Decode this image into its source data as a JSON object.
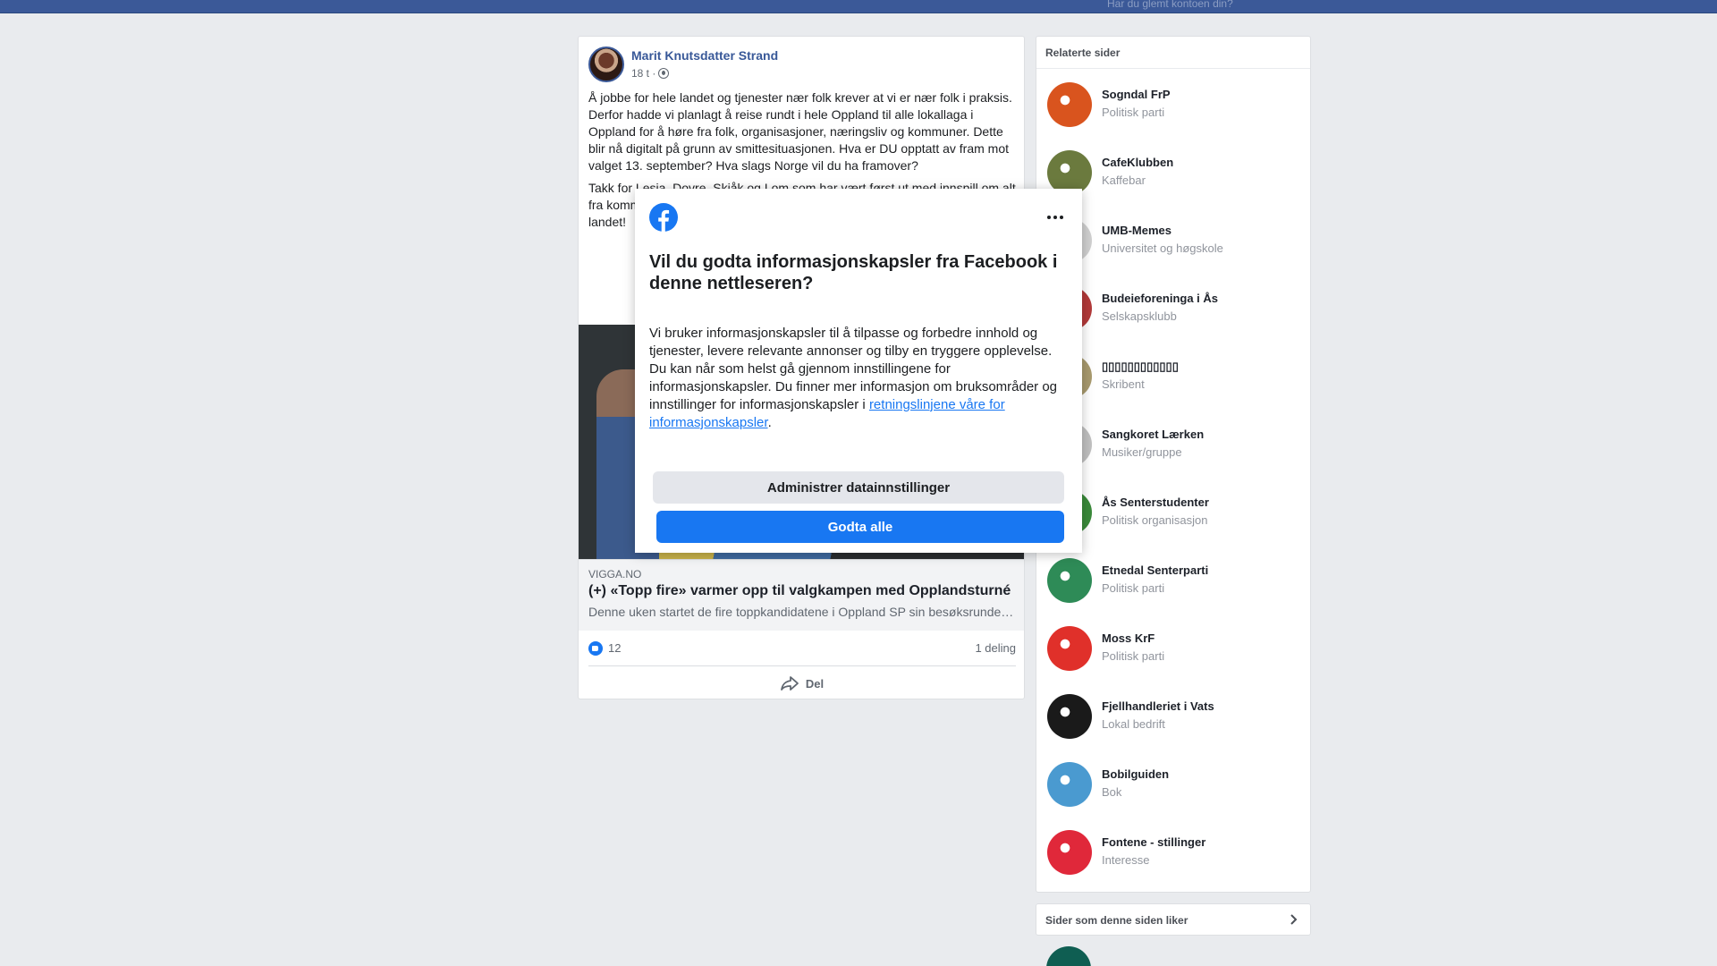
{
  "topbar": {
    "forgot_text": "Har du glemt kontoen din?"
  },
  "post": {
    "author": "Marit Knutsdatter Strand",
    "time": "18 t ·",
    "paragraph1": "Å jobbe for hele landet og tjenester nær folk krever at vi er nær folk i praksis. Derfor hadde vi planlagt å reise rundt i hele Oppland til alle lokallaga i Oppland for å høre fra folk, organisasjoner, næringsliv og kommuner. Dette blir nå digitalt på grunn av smittesituasjonen. Hva er DU opptatt av fram mot valget 13. september? Hva slags Norge vil du ha framover?",
    "paragraph2": "Takk for Lesja, Dovre, Skjåk og Lom som har vært først ut med innspill om alt fra kommunene, matproduksjon, utvikle lo... stand til... kommun... tjenester... landet!",
    "link": {
      "domain": "VIGGA.NO",
      "title": "(+) «Topp fire» varmer opp til valgkampen med Opplandsturné",
      "description": "Denne uken startet de fire toppkandidatene i Oppland SP sin besøksrunde…"
    },
    "likes_count": "12",
    "shares": "1 deling",
    "share_label": "Del"
  },
  "related": {
    "title": "Relaterte sider",
    "items": [
      {
        "name": "Sogndal FrP",
        "category": "Politisk parti",
        "color": "#d9541e",
        "icon": "frp-logo"
      },
      {
        "name": "CafeKlubben",
        "category": "Kaffebar",
        "color": "#6b7a3e",
        "icon": "cafe-logo"
      },
      {
        "name": "UMB-Memes",
        "category": "Universitet og høgskole",
        "color": "#d0d0d0",
        "icon": "umb-logo"
      },
      {
        "name": "Budeieforeninga i Ås",
        "category": "Selskapsklubb",
        "color": "#b33a3a",
        "icon": "budeie-logo"
      },
      {
        "name": "▯▯▯▯▯▯▯▯▯▯▯▯",
        "category": "Skribent",
        "color": "#a89a6e",
        "icon": "writer-avatar"
      },
      {
        "name": "Sangkoret Lærken",
        "category": "Musiker/gruppe",
        "color": "#c0c0c0",
        "icon": "choir-logo"
      },
      {
        "name": "Ås Senterstudenter",
        "category": "Politisk organisasjon",
        "color": "#3a8a3a",
        "icon": "sp-logo"
      },
      {
        "name": "Etnedal Senterparti",
        "category": "Politisk parti",
        "color": "#2e8b57",
        "icon": "sp-clover-logo"
      },
      {
        "name": "Moss KrF",
        "category": "Politisk parti",
        "color": "#e0302a",
        "icon": "krf-logo"
      },
      {
        "name": "Fjellhandleriet i Vats",
        "category": "Lokal bedrift",
        "color": "#1a1a1a",
        "icon": "flower-logo"
      },
      {
        "name": "Bobilguiden",
        "category": "Bok",
        "color": "#4a9ad0",
        "icon": "landscape-logo"
      },
      {
        "name": "Fontene - stillinger",
        "category": "Interesse",
        "color": "#e0283a",
        "icon": "jobb-logo"
      }
    ]
  },
  "liked_pages": {
    "title": "Sider som denne siden liker"
  },
  "modal": {
    "title": "Vil du godta informasjonskapsler fra Facebook i denne nettleseren?",
    "body": "Vi bruker informasjonskapsler til å tilpasse og forbedre innhold og tjenester, levere relevante annonser og tilby en tryggere opplevelse. Du kan når som helst gå gjennom innstillingene for informasjonskapsler. Du finner mer informasjon om bruksområder og innstillinger for informasjonskapsler i ",
    "link_text": "retningslinjene våre for informasjonskapsler",
    "body_end": ".",
    "manage_label": "Administrer datainnstillinger",
    "accept_label": "Godta alle"
  },
  "colors": {
    "facebook_blue": "#1877f2",
    "header_blue": "#3b5998"
  }
}
